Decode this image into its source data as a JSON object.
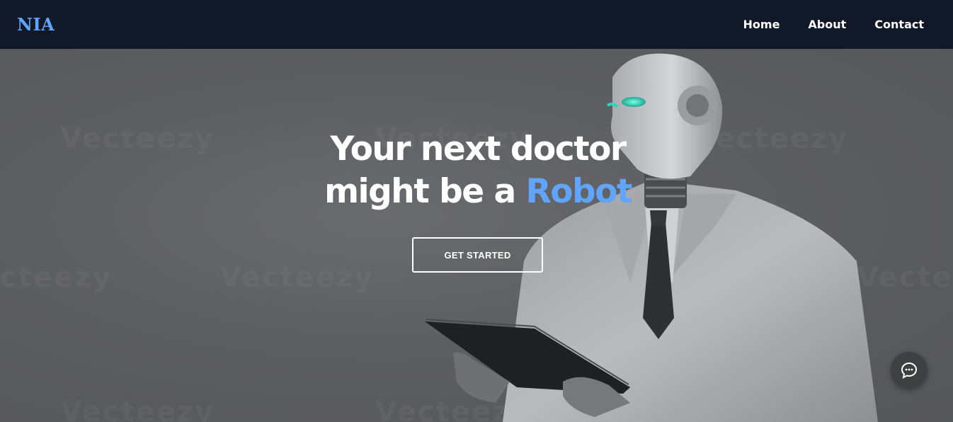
{
  "brand": {
    "logo_text": "NIA",
    "accent_color": "#60a5fa",
    "nav_bg": "#111827"
  },
  "nav": {
    "items": [
      {
        "label": "Home"
      },
      {
        "label": "About"
      },
      {
        "label": "Contact"
      }
    ]
  },
  "hero": {
    "title_line1": "Your next doctor",
    "title_line2_prefix": "might be a ",
    "title_highlight": "Robot",
    "cta_label": "GET STARTED"
  },
  "watermark": {
    "text": "Vecteezy"
  },
  "icons": {
    "chat": "chat-bubble-icon"
  }
}
